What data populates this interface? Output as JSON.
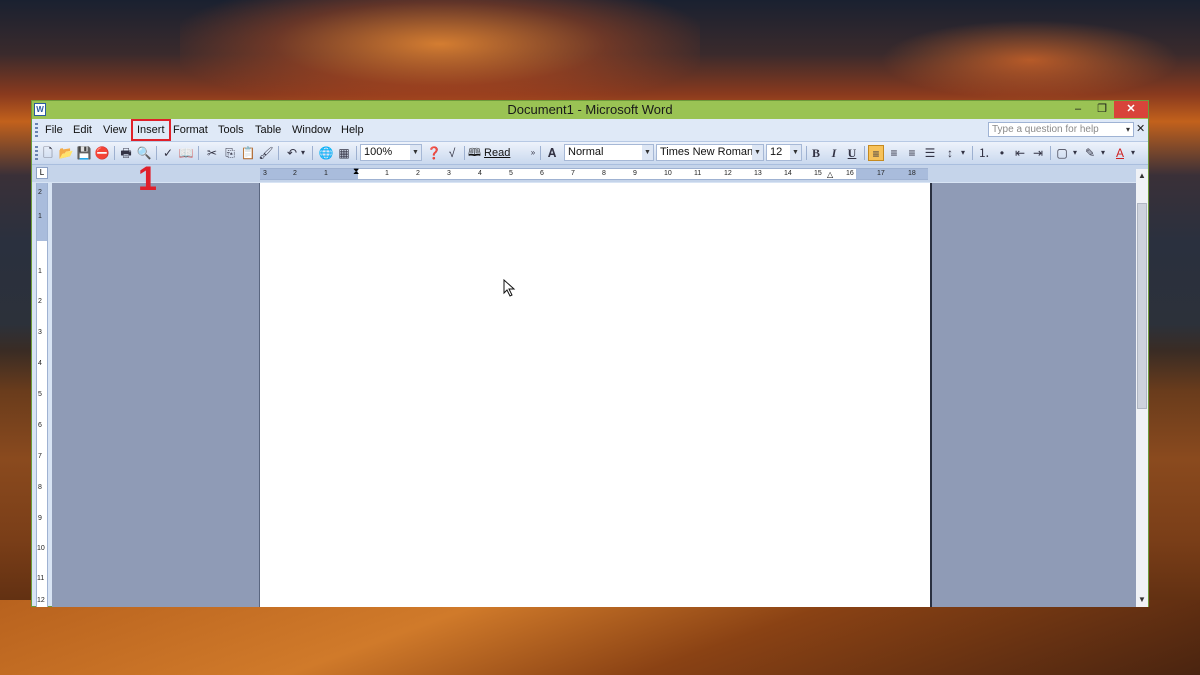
{
  "window": {
    "title": "Document1 - Microsoft Word",
    "app_icon_text": "W"
  },
  "window_controls": {
    "minimize": "–",
    "restore": "❐",
    "close": "✕"
  },
  "menu": {
    "items": [
      {
        "key": "file",
        "label": "File"
      },
      {
        "key": "edit",
        "label": "Edit"
      },
      {
        "key": "view",
        "label": "View"
      },
      {
        "key": "insert",
        "label": "Insert"
      },
      {
        "key": "format",
        "label": "Format"
      },
      {
        "key": "tools",
        "label": "Tools"
      },
      {
        "key": "table",
        "label": "Table"
      },
      {
        "key": "window",
        "label": "Window"
      },
      {
        "key": "help",
        "label": "Help"
      }
    ],
    "help_placeholder": "Type a question for help",
    "doc_close": "✕"
  },
  "toolbar": {
    "zoom": "100%",
    "read_label": "Read",
    "style": "Normal",
    "font": "Times New Roman",
    "size": "12",
    "bold": "B",
    "italic": "I",
    "underline": "U",
    "icons": [
      "new-icon",
      "open-icon",
      "save-icon",
      "permission-icon",
      "print-icon",
      "print-preview-icon",
      "spelling-icon",
      "research-icon",
      "cut-icon",
      "copy-icon",
      "paste-icon",
      "format-painter-icon",
      "undo-icon",
      "hyperlink-icon",
      "table-icon",
      "help-icon",
      "equation-icon",
      "styles-icon",
      "align-left-icon",
      "center-icon",
      "align-right-icon",
      "justify-icon",
      "line-spacing-icon",
      "numbering-icon",
      "bullets-icon",
      "decrease-indent-icon",
      "increase-indent-icon",
      "border-icon",
      "highlight-icon",
      "font-color-icon"
    ],
    "accent_color": "#f7c25a"
  },
  "ruler": {
    "horizontal_labels": [
      "3",
      "2",
      "1",
      "1",
      "2",
      "3",
      "4",
      "5",
      "6",
      "7",
      "8",
      "9",
      "10",
      "11",
      "12",
      "13",
      "14",
      "15",
      "16",
      "17",
      "18"
    ],
    "vertical_labels": [
      "2",
      "1",
      "1",
      "2",
      "3",
      "4",
      "5",
      "6",
      "7",
      "8",
      "9",
      "10",
      "11",
      "12"
    ],
    "tab_selector": "L"
  },
  "annotation": {
    "step": "1",
    "color": "#e0202a"
  },
  "colors": {
    "title_bar": "#9ac354",
    "close_button": "#d8443a",
    "workspace": "#8f9bb6"
  }
}
